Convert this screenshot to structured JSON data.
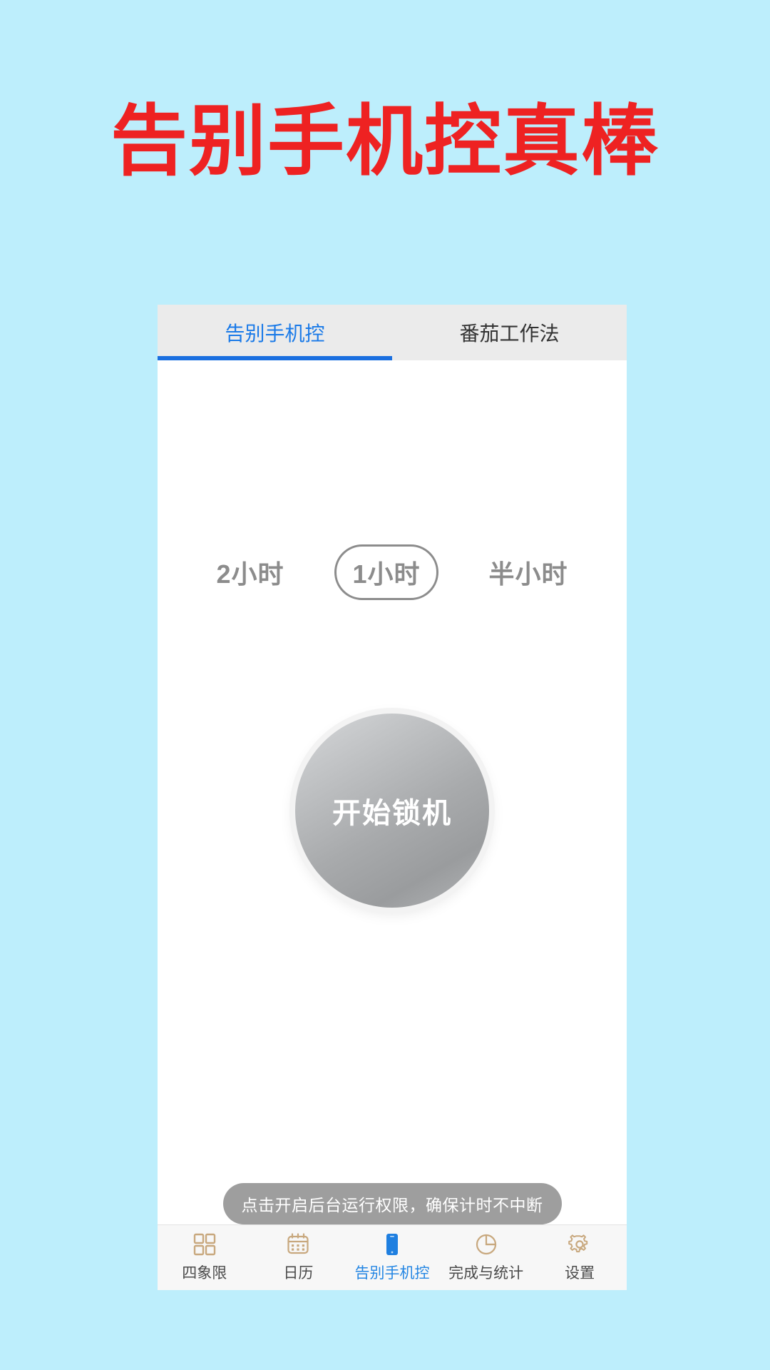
{
  "headline": {
    "text": "告别手机控真棒",
    "color": "#ee2222"
  },
  "background_color": "#bdeefc",
  "app": {
    "tabs": [
      {
        "label": "告别手机控",
        "active": true
      },
      {
        "label": "番茄工作法",
        "active": false
      }
    ],
    "tab_accent_color": "#1a6fe0",
    "durations": [
      {
        "label": "2小时",
        "selected": false
      },
      {
        "label": "1小时",
        "selected": true
      },
      {
        "label": "半小时",
        "selected": false
      }
    ],
    "lock_button": {
      "label": "开始锁机"
    },
    "hint": {
      "text": "点击开启后台运行权限，确保计时不中断"
    },
    "bottom_nav": {
      "active_color": "#2486e3",
      "icon_color": "#c8a87e",
      "items": [
        {
          "label": "四象限",
          "icon": "grid-icon",
          "active": false
        },
        {
          "label": "日历",
          "icon": "calendar-icon",
          "active": false
        },
        {
          "label": "告别手机控",
          "icon": "phone-icon",
          "active": true
        },
        {
          "label": "完成与统计",
          "icon": "pie-chart-icon",
          "active": false
        },
        {
          "label": "设置",
          "icon": "gear-icon",
          "active": false
        }
      ]
    }
  }
}
